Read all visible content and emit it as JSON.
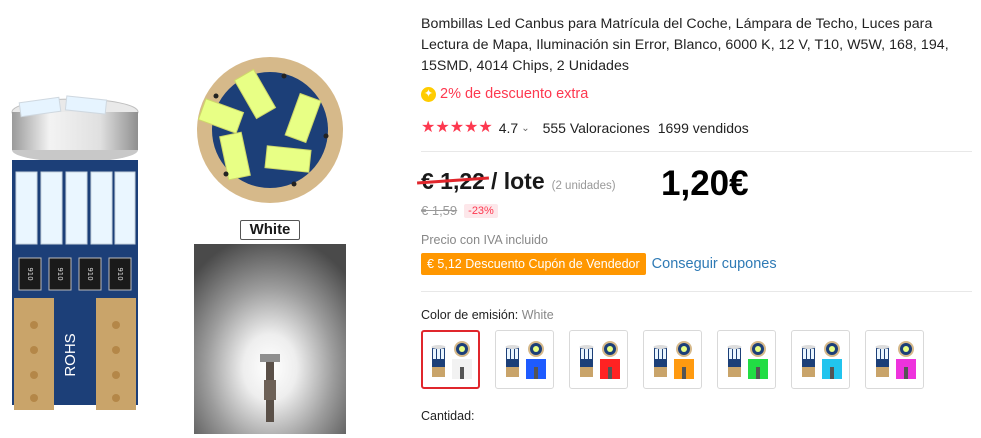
{
  "product": {
    "title": "Bombillas Led Canbus para Matrícula del Coche, Lámpara de Techo, Luces para Lectura de Mapa, Iluminación sin Error, Blanco, 6000 K, 12 V, T10, W5W, 168, 194, 15SMD, 4014 Chips, 2 Unidades",
    "promo_text": "2% de descuento extra",
    "promo_icon": "coin-icon",
    "rating_value": "4.7",
    "rating_stars": 5,
    "reviews": "555 Valoraciones",
    "sold": "1699 vendidos"
  },
  "gallery": {
    "bulb_pcb_text": "ROHS",
    "chip_text": "910",
    "white_label": "White"
  },
  "price": {
    "current": "€ 1,22",
    "unit": "/ lote",
    "units_note": "(2 unidades)",
    "handwritten": "1,20€",
    "original": "€ 1,59",
    "discount": "-23%",
    "iva": "Precio con IVA incluido"
  },
  "coupon": {
    "label": "€ 5,12 Descuento Cupón de Vendedor",
    "link": "Conseguir cupones"
  },
  "color": {
    "label": "Color de emisión:",
    "selected": "White",
    "swatches": [
      {
        "name": "White",
        "glow": "#f2f2f2"
      },
      {
        "name": "Blue",
        "glow": "#1e5bff"
      },
      {
        "name": "Red",
        "glow": "#ff2222"
      },
      {
        "name": "Yellow",
        "glow": "#ff9a10"
      },
      {
        "name": "Green",
        "glow": "#22dd44"
      },
      {
        "name": "Ice Blue",
        "glow": "#22c4ee"
      },
      {
        "name": "Pink",
        "glow": "#ee33dd"
      }
    ]
  },
  "quantity": {
    "label": "Cantidad:"
  },
  "colors": {
    "accent": "#fd384f",
    "coupon_bg": "#ff9700",
    "link": "#2e7ab5"
  }
}
